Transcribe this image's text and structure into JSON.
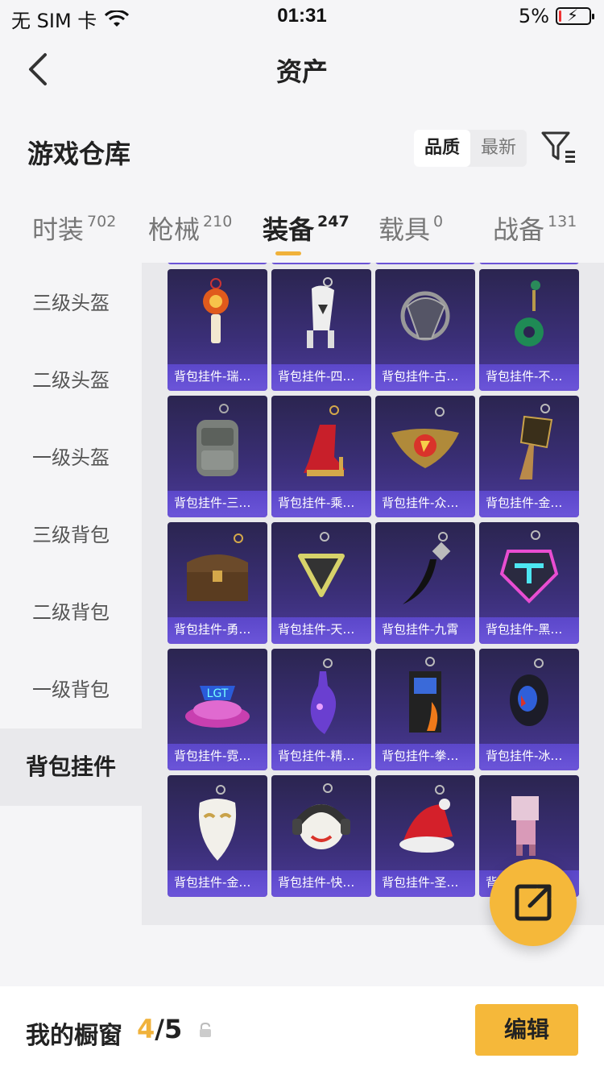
{
  "status_bar": {
    "carrier": "无 SIM 卡",
    "time": "01:31",
    "battery_percent": "5%",
    "battery_level": 0.05
  },
  "nav": {
    "title": "资产",
    "back_icon": "chevron-left-icon"
  },
  "warehouse": {
    "title": "游戏仓库",
    "sort_options": [
      "品质",
      "最新"
    ],
    "sort_selected": "品质",
    "filter_icon": "filter-list-icon"
  },
  "category_tabs": [
    {
      "label": "时装",
      "count": "702",
      "active": false
    },
    {
      "label": "枪械",
      "count": "210",
      "active": false
    },
    {
      "label": "装备",
      "count": "247",
      "active": true
    },
    {
      "label": "载具",
      "count": "0",
      "active": false
    },
    {
      "label": "战备",
      "count": "131",
      "active": false
    }
  ],
  "sidebar": {
    "items": [
      {
        "label": "三级头盔",
        "active": false
      },
      {
        "label": "二级头盔",
        "active": false
      },
      {
        "label": "一级头盔",
        "active": false
      },
      {
        "label": "三级背包",
        "active": false
      },
      {
        "label": "二级背包",
        "active": false
      },
      {
        "label": "一级背包",
        "active": false
      },
      {
        "label": "背包挂件",
        "active": true
      }
    ]
  },
  "grid_items": [
    {
      "label": "背包挂件-瑞…",
      "icon": "lucky-charm-pendant-icon"
    },
    {
      "label": "背包挂件-四…",
      "icon": "robot-pendant-icon"
    },
    {
      "label": "背包挂件-古…",
      "icon": "dragon-emblem-pendant-icon"
    },
    {
      "label": "背包挂件-不…",
      "icon": "jade-pendant-icon"
    },
    {
      "label": "背包挂件-三…",
      "icon": "backpack-pendant-icon"
    },
    {
      "label": "背包挂件-乘…",
      "icon": "high-heel-pendant-icon"
    },
    {
      "label": "背包挂件-众…",
      "icon": "winged-badge-pendant-icon"
    },
    {
      "label": "背包挂件-金…",
      "icon": "golden-tassel-pendant-icon"
    },
    {
      "label": "背包挂件-勇…",
      "icon": "treasure-chest-pendant-icon"
    },
    {
      "label": "背包挂件-天…",
      "icon": "triangle-pendant-icon"
    },
    {
      "label": "背包挂件-九霄",
      "icon": "feather-pendant-icon"
    },
    {
      "label": "背包挂件-黑…",
      "icon": "neon-logo-pendant-icon"
    },
    {
      "label": "背包挂件-霓…",
      "icon": "neon-stage-pendant-icon"
    },
    {
      "label": "背包挂件-精…",
      "icon": "potion-bottle-pendant-icon"
    },
    {
      "label": "背包挂件-拳…",
      "icon": "arcade-cabinet-pendant-icon"
    },
    {
      "label": "背包挂件-冰…",
      "icon": "ice-helmet-pendant-icon"
    },
    {
      "label": "背包挂件-金…",
      "icon": "masquerade-mask-pendant-icon"
    },
    {
      "label": "背包挂件-快…",
      "icon": "emoji-headphones-pendant-icon"
    },
    {
      "label": "背包挂件-圣…",
      "icon": "santa-hat-pendant-icon"
    },
    {
      "label": "背包挂件-冰…",
      "icon": "pixel-character-pendant-icon"
    }
  ],
  "share_button": {
    "icon": "share-external-icon"
  },
  "showcase": {
    "label": "我的橱窗",
    "current": "4",
    "separator_total": "/5",
    "lock_icon": "lock-icon",
    "edit_label": "编辑"
  },
  "colors": {
    "accent": "#f5b83a",
    "card_bg": "#3b2f78",
    "card_label_bg": "#6a54d8"
  }
}
